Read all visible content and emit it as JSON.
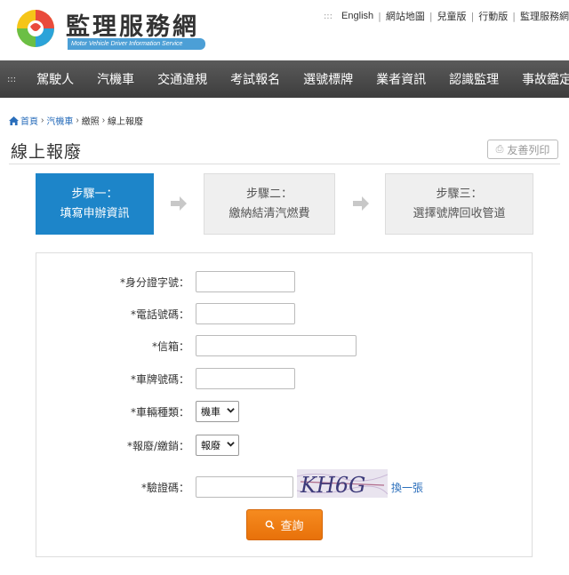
{
  "header": {
    "logo_title": "監理服務網",
    "logo_subtitle": "Motor Vehicle Driver Information Service",
    "links": [
      "English",
      "網站地圖",
      "兒童版",
      "行動版",
      "監理服務網"
    ]
  },
  "nav": {
    "items": [
      "駕駛人",
      "汽機車",
      "交通違規",
      "考試報名",
      "選號標牌",
      "業者資訊",
      "認識監理",
      "事故鑑定"
    ]
  },
  "breadcrumb": {
    "home": "首頁",
    "level1": "汽機車",
    "level2": "繳照",
    "current": "線上報廢"
  },
  "page": {
    "title": "線上報廢",
    "print_label": "友善列印"
  },
  "steps": [
    {
      "title": "步驟一：",
      "desc": "填寫申辦資訊",
      "state": "active"
    },
    {
      "title": "步驟二：",
      "desc": "繳納結清汽燃費",
      "state": "inactive"
    },
    {
      "title": "步驟三：",
      "desc": "選擇號牌回收管道",
      "state": "inactive"
    }
  ],
  "form": {
    "id_label": "*身分證字號：",
    "id_value": "",
    "phone_label": "*電話號碼：",
    "phone_value": "",
    "email_label": "*信箱：",
    "email_value": "",
    "plate_label": "*車牌號碼：",
    "plate_value": "",
    "vehicle_type_label": "*車輛種類：",
    "vehicle_type_value": "機車",
    "action_label": "*報廢/繳銷：",
    "action_value": "報廢",
    "captcha_label": "*驗證碼：",
    "captcha_value": "",
    "captcha_text": "KH6G",
    "refresh_label": "換一張",
    "submit_label": "查詢"
  },
  "colors": {
    "active_step": "#1d85c9",
    "nav_bg": "#4a4a4a",
    "submit": "#f07e14",
    "link": "#2a6ebb"
  }
}
